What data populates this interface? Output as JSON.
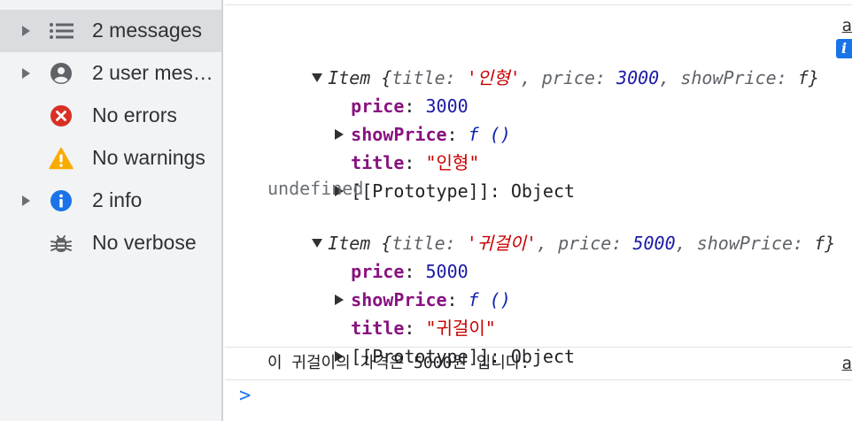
{
  "sidebar": {
    "items": [
      {
        "label": "2 messages",
        "icon": "list-icon",
        "expandable": true,
        "selected": true
      },
      {
        "label": "2 user mes…",
        "icon": "user-icon",
        "expandable": true,
        "selected": false
      },
      {
        "label": "No errors",
        "icon": "error-icon",
        "expandable": false,
        "selected": false
      },
      {
        "label": "No warnings",
        "icon": "warning-icon",
        "expandable": false,
        "selected": false
      },
      {
        "label": "2 info",
        "icon": "info-icon",
        "expandable": true,
        "selected": false
      },
      {
        "label": "No verbose",
        "icon": "bug-icon",
        "expandable": false,
        "selected": false
      }
    ]
  },
  "console": {
    "source_link_1": "a",
    "source_link_2": "a",
    "info_badge": "i",
    "log1": {
      "header": {
        "class_name": "Item",
        "open_brace": "{",
        "title_key": "title",
        "title_value": "'인형'",
        "price_key": "price",
        "price_value": "3000",
        "show_key": "showPrice",
        "show_value": "f",
        "close_brace": "}"
      },
      "price_key": "price",
      "price_value": "3000",
      "show_key": "showPrice",
      "show_value": "f ()",
      "title_key": "title",
      "title_value": "\"인형\"",
      "proto_key": "[[Prototype]]",
      "proto_value": "Object"
    },
    "undefined_text": "undefined",
    "log2": {
      "header": {
        "class_name": "Item",
        "open_brace": "{",
        "title_key": "title",
        "title_value": "'귀걸이'",
        "price_key": "price",
        "price_value": "5000",
        "show_key": "showPrice",
        "show_value": "f",
        "close_brace": "}"
      },
      "price_key": "price",
      "price_value": "5000",
      "show_key": "showPrice",
      "show_value": "f ()",
      "title_key": "title",
      "title_value": "\"귀걸이\"",
      "proto_key": "[[Prototype]]",
      "proto_value": "Object"
    },
    "message": "이 귀걸이의 가격은 5000원 입니다.",
    "prompt": ">"
  },
  "colors": {
    "accent": "#1a73e8",
    "error": "#d93025",
    "warning": "#f9ab00",
    "prop": "#881280",
    "number": "#1a1aa6",
    "string": "#c80000"
  }
}
